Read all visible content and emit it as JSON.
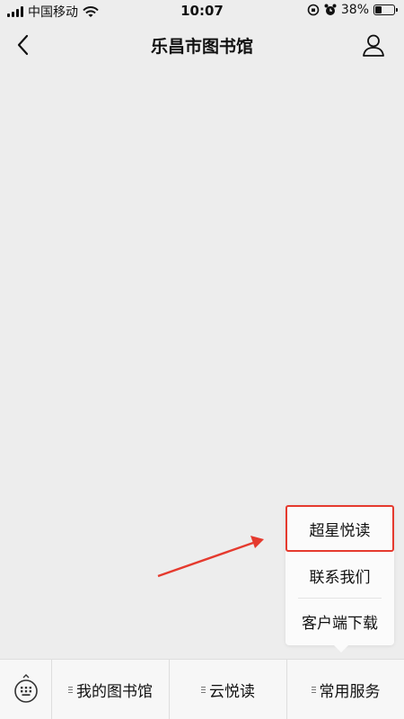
{
  "status_bar": {
    "carrier": "中国移动",
    "time": "10:07",
    "battery": "38%",
    "battery_level": 0.38
  },
  "nav": {
    "title": "乐昌市图书馆",
    "back_icon": "chevron-left-icon",
    "profile_icon": "user-icon"
  },
  "popup_menu": {
    "items": [
      {
        "label": "超星悦读",
        "highlighted": true
      },
      {
        "label": "联系我们"
      },
      {
        "label": "客户端下载"
      }
    ],
    "highlight_color": "#e53a2e"
  },
  "bottom_menu": {
    "keyboard_icon": "keyboard-icon",
    "tabs": [
      {
        "label": "我的图书馆"
      },
      {
        "label": "云悦读"
      },
      {
        "label": "常用服务"
      }
    ]
  },
  "colors": {
    "background": "#ededed",
    "annotation_arrow": "#e53a2e"
  }
}
